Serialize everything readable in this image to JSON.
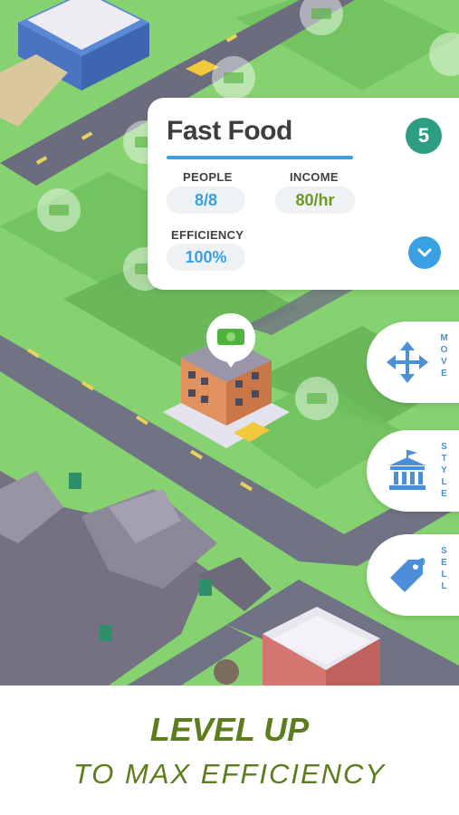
{
  "building_card": {
    "title": "Fast Food",
    "level": "5",
    "people_label": "PEOPLE",
    "people_value": "8/8",
    "income_label": "INCOME",
    "income_value": "80/hr",
    "efficiency_label": "EFFICIENCY",
    "efficiency_value": "100%"
  },
  "side_actions": [
    {
      "label": "MOVE",
      "icon": "move-arrows-icon"
    },
    {
      "label": "STYLE",
      "icon": "bank-building-icon"
    },
    {
      "label": "SELL",
      "icon": "price-tag-icon"
    }
  ],
  "caption": {
    "line1": "LEVEL UP",
    "line2": "TO MAX EFFICIENCY"
  },
  "colors": {
    "accent_blue": "#3aa0e4",
    "level_badge": "#2e9e82",
    "income_green": "#6e9a1c",
    "caption_green": "#5b7d1c",
    "grass": "#8fd67a"
  }
}
